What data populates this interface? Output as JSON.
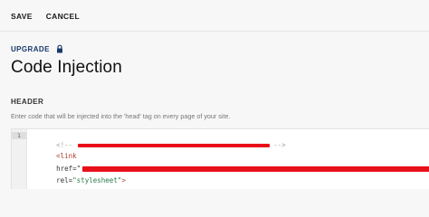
{
  "toolbar": {
    "save_label": "SAVE",
    "cancel_label": "CANCEL"
  },
  "upgrade": {
    "label": "UPGRADE",
    "icon": "lock-icon"
  },
  "page": {
    "title": "Code Injection"
  },
  "header_section": {
    "label": "HEADER",
    "help": "Enter code that will be injected into the 'head' tag on every page of your site."
  },
  "editor": {
    "line_numbers": [
      "1",
      "",
      "",
      "",
      ""
    ],
    "lines": {
      "comment_open": "<!--",
      "comment_close": "-->",
      "link_tag": "<link",
      "href_attr": "href=\"",
      "rel_attr": "rel=",
      "rel_value": "\"stylesheet\"",
      "close": ">"
    }
  },
  "colors": {
    "accent": "#1a3a6b",
    "redaction": "#e8111a"
  }
}
